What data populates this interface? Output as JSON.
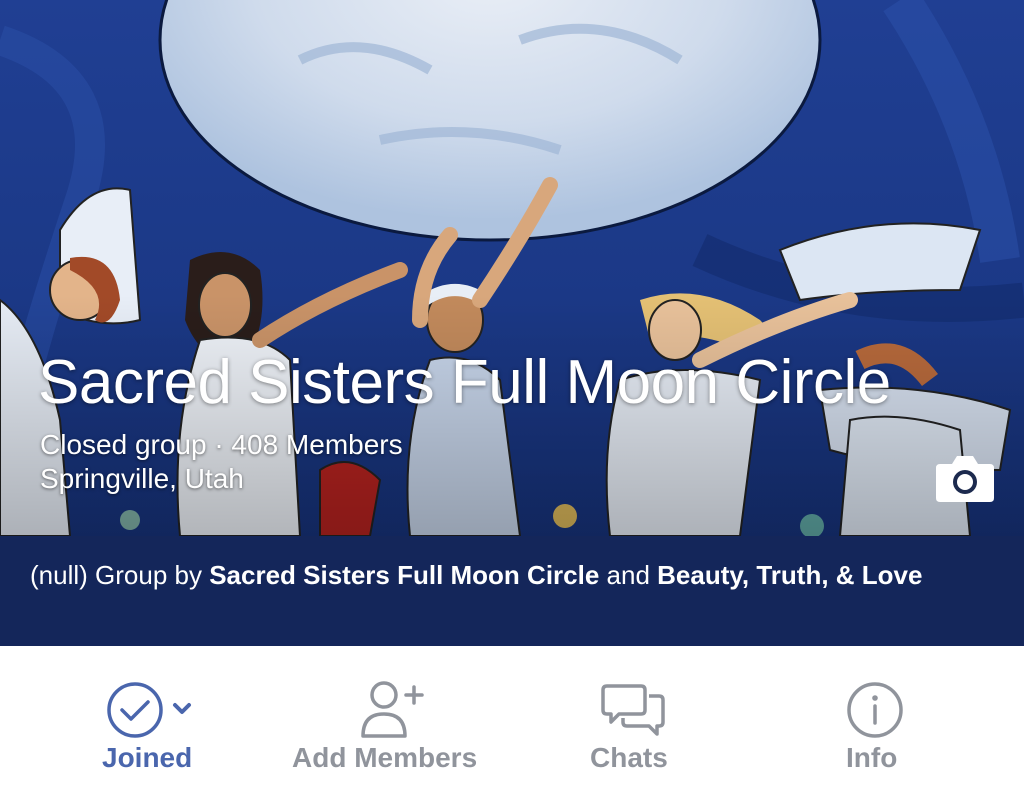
{
  "group": {
    "name": "Sacred Sisters Full Moon Circle",
    "privacy_members": "Closed group · 408 Members",
    "location": "Springville, Utah"
  },
  "banner": {
    "prefix": "(null) Group by ",
    "owner1": "Sacred Sisters Full Moon Circle",
    "joiner": " and ",
    "owner2": "Beauty, Truth, & Love"
  },
  "actions": {
    "joined": {
      "label": "Joined",
      "icon": "check-circle-icon"
    },
    "add_members": {
      "label": "Add Members",
      "icon": "add-person-icon"
    },
    "chats": {
      "label": "Chats",
      "icon": "chat-bubbles-icon"
    },
    "info": {
      "label": "Info",
      "icon": "info-icon"
    }
  },
  "colors": {
    "accent": "#4a66ad",
    "inactive": "#90949c",
    "banner_bg": "#14265a",
    "cover_blue": "#1d3f8e"
  }
}
